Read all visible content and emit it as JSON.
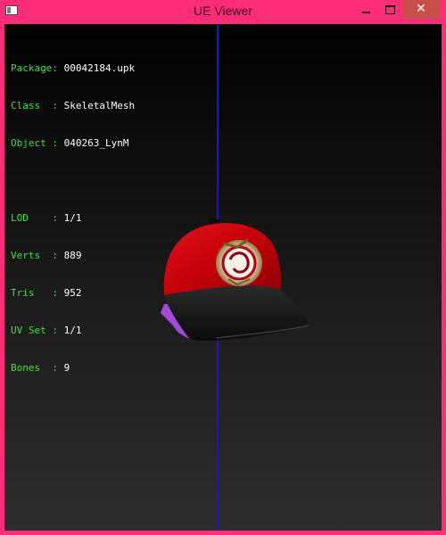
{
  "window": {
    "title": "UE Viewer",
    "controls": {
      "minimize": "minimize",
      "maximize": "maximize",
      "close": "✕"
    }
  },
  "info": {
    "package": {
      "label": "Package:",
      "value": "00042184.upk"
    },
    "class": {
      "label": "Class  :",
      "value": "SkeletalMesh"
    },
    "object": {
      "label": "Object :",
      "value": "040263_LynM"
    },
    "lod": {
      "label": "LOD    :",
      "value": "1/1"
    },
    "verts": {
      "label": "Verts  :",
      "value": "889"
    },
    "tris": {
      "label": "Tris   :",
      "value": "952"
    },
    "uvset": {
      "label": "UV Set :",
      "value": "1/1"
    },
    "bones": {
      "label": "Bones  :",
      "value": "9"
    }
  },
  "colors": {
    "frame": "#ff2d78",
    "label_green": "#3de23d",
    "axis_blue": "#1a1ab8",
    "cap_red": "#c8000a",
    "cap_brim": "#141414",
    "ribbon": "#a44ad6"
  },
  "model_icon": "baseball-cap-mesh"
}
